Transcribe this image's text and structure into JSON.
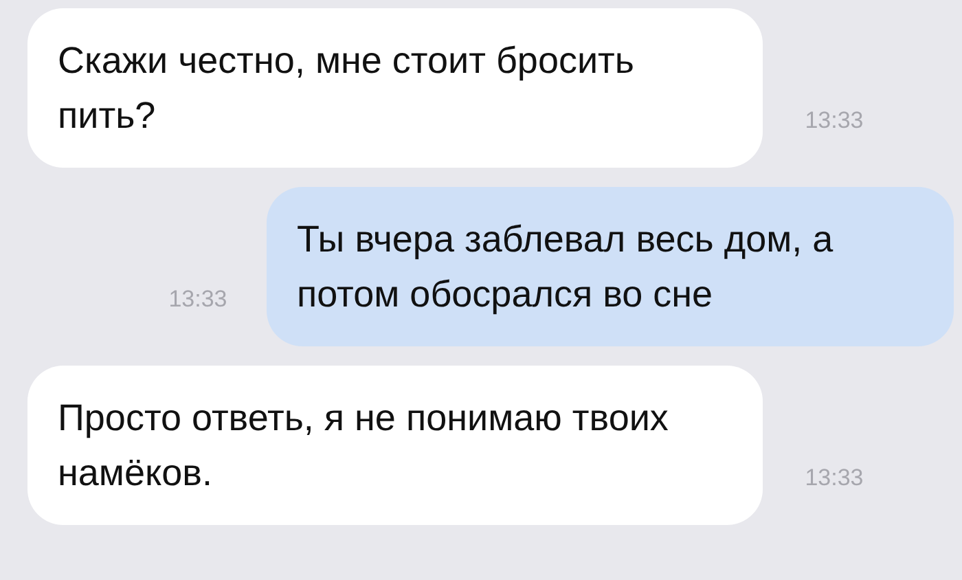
{
  "messages": [
    {
      "kind": "incoming",
      "text": "Скажи честно, мне стоит бросить пить?",
      "time": "13:33"
    },
    {
      "kind": "outgoing",
      "text": "Ты вчера заблевал весь дом, а потом обосрался во сне",
      "time": "13:33"
    },
    {
      "kind": "incoming",
      "text": "Просто ответь, я не понимаю твоих намёков.",
      "time": "13:33"
    }
  ]
}
